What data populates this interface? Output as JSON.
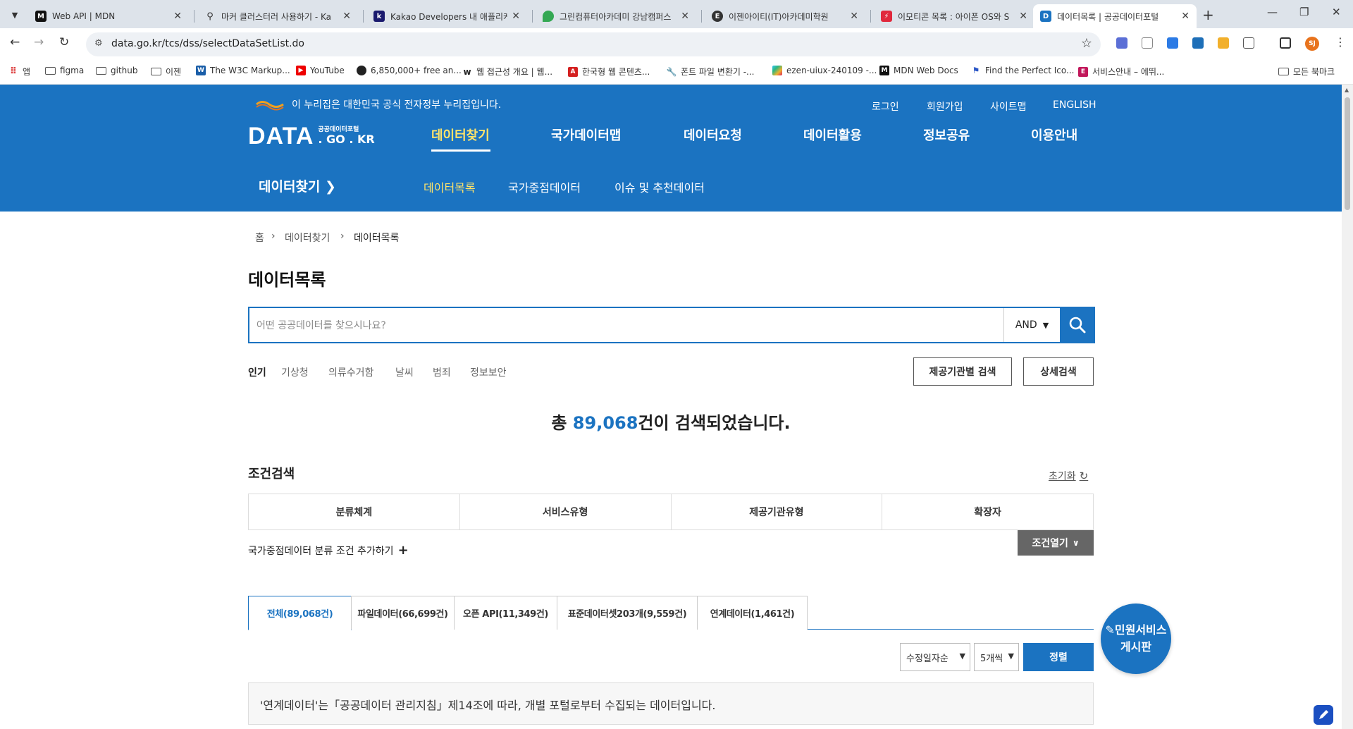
{
  "browser": {
    "tabs": [
      {
        "title": "Web API | MDN",
        "icon": "mdn-icon",
        "active": false
      },
      {
        "title": "마커 클러스터러 사용하기 - Ka",
        "icon": "map-pin-icon",
        "active": false
      },
      {
        "title": "Kakao Developers 내 애플리케",
        "icon": "kakao-icon",
        "active": false
      },
      {
        "title": "그린컴퓨터아카데미 강남캠퍼스",
        "icon": "maps-icon",
        "active": false
      },
      {
        "title": "이젠아이티(IT)아카데미학원",
        "icon": "ezen-icon",
        "active": false
      },
      {
        "title": "이모티콘 목록 : 아이폰 OS와 S",
        "icon": "bolt-icon",
        "active": false
      },
      {
        "title": "데이터목록 | 공공데이터포털",
        "icon": "data-portal-icon",
        "active": true
      }
    ],
    "url": "data.go.kr/tcs/dss/selectDataSetList.do",
    "avatar": "SJ",
    "bookmarks": [
      {
        "label": "앱",
        "icon": "apps-grid-icon"
      },
      {
        "label": "figma",
        "icon": "folder-icon"
      },
      {
        "label": "github",
        "icon": "folder-icon"
      },
      {
        "label": "이젠",
        "icon": "folder-icon"
      },
      {
        "label": "The W3C Markup...",
        "icon": "w3c-icon"
      },
      {
        "label": "YouTube",
        "icon": "youtube-icon"
      },
      {
        "label": "6,850,000+ free an...",
        "icon": "flaticon-icon"
      },
      {
        "label": "웹 접근성 개요 | 웹...",
        "icon": "web-icon"
      },
      {
        "label": "한국형 웹 콘텐츠...",
        "icon": "pdf-icon"
      },
      {
        "label": "폰트 파일 변환기 -...",
        "icon": "wrench-icon"
      },
      {
        "label": "ezen-uiux-240109 -...",
        "icon": "slack-icon"
      },
      {
        "label": "MDN Web Docs",
        "icon": "mdn-icon"
      },
      {
        "label": "Find the Perfect Ico...",
        "icon": "flag-icon"
      },
      {
        "label": "서비스안내 – 에뛰...",
        "icon": "e-icon"
      }
    ],
    "all_bookmarks": "모든 북마크"
  },
  "header": {
    "gov_notice": "이 누리집은 대한민국 공식 전자정부 누리집입니다.",
    "util": [
      "로그인",
      "회원가입",
      "사이트맵",
      "ENGLISH"
    ],
    "logo_main": "DATA",
    "logo_sub_top": "공공데이터포털",
    "logo_sub_bottom": ". GO . KR",
    "gnb": [
      "데이터찾기",
      "국가데이터맵",
      "데이터요청",
      "데이터활용",
      "정보공유",
      "이용안내"
    ],
    "section_title": "데이터찾기",
    "lnb": [
      "데이터목록",
      "국가중점데이터",
      "이슈 및 추천데이터"
    ]
  },
  "breadcrumb": [
    "홈",
    "데이터찾기",
    "데이터목록"
  ],
  "page_title": "데이터목록",
  "search": {
    "placeholder": "어떤 공공데이터를 찾으시나요?",
    "operator": "AND"
  },
  "keywords": [
    "인기",
    "기상청",
    "의류수거함",
    "날씨",
    "범죄",
    "정보보안"
  ],
  "buttons": {
    "org_search": "제공기관별 검색",
    "detail_search": "상세검색",
    "open_conditions": "조건열기",
    "sort": "정렬"
  },
  "result": {
    "prefix": "총 ",
    "count": "89,068",
    "suffix": "건이 검색되었습니다."
  },
  "conditions": {
    "title": "조건검색",
    "reset": "초기화",
    "columns": [
      "분류체계",
      "서비스유형",
      "제공기관유형",
      "확장자"
    ],
    "add_label": "국가중점데이터 분류 조건 추가하기"
  },
  "data_tabs": [
    "전체(89,068건)",
    "파일데이터(66,699건)",
    "오픈 API(11,349건)",
    "표준데이터셋203개(9,559건)",
    "연계데이터(1,461건)"
  ],
  "sort_options": {
    "order": "수정일자순",
    "per_page": "5개씩"
  },
  "notice": "'연계데이터'는「공공데이터 관리지침」제14조에 따라, 개별 포털로부터 수집되는 데이터입니다.",
  "float_button": {
    "line1": "민원서비스",
    "line2": "게시판"
  },
  "colors": {
    "brand": "#1b73c1",
    "active_menu": "#ffe36a"
  }
}
